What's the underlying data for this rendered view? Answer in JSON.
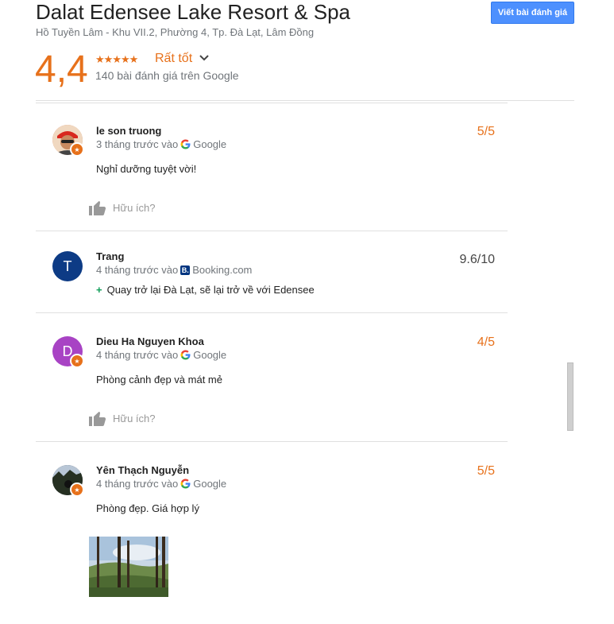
{
  "header": {
    "title": "Dalat Edensee Lake Resort & Spa",
    "address": "Hồ Tuyền Lâm - Khu VII.2, Phường 4, Tp. Đà Lạt, Lâm Đồng",
    "write_review_label": "Viết bài đánh giá",
    "rating": "4,4",
    "rating_stars": 4.4,
    "rating_label": "Rất tốt",
    "review_count": "140 bài đánh giá trên Google"
  },
  "colors": {
    "accent": "#e7711b",
    "button": "#4d90fe",
    "booking": "#003580"
  },
  "reviews": [
    {
      "name": "le son truong",
      "time": "3 tháng trước vào",
      "source": "Google",
      "score": "5/5",
      "text": "Nghỉ dưỡng tuyệt vời!",
      "helpful": "Hữu ích?"
    },
    {
      "name": "Trang",
      "avatar_letter": "T",
      "time": "4 tháng trước vào",
      "source": "Booking.com",
      "score": "9.6/10",
      "text": "Quay trở lại Đà Lạt, sẽ lại trở về với Edensee"
    },
    {
      "name": "Dieu Ha Nguyen Khoa",
      "avatar_letter": "D",
      "time": "4 tháng trước vào",
      "source": "Google",
      "score": "4/5",
      "text": "Phòng cảnh đẹp và mát mẻ",
      "helpful": "Hữu ích?"
    },
    {
      "name": "Yên Thạch Nguyễn",
      "time": "4 tháng trước vào",
      "source": "Google",
      "score": "5/5",
      "text": "Phòng đẹp. Giá hợp lý"
    }
  ]
}
